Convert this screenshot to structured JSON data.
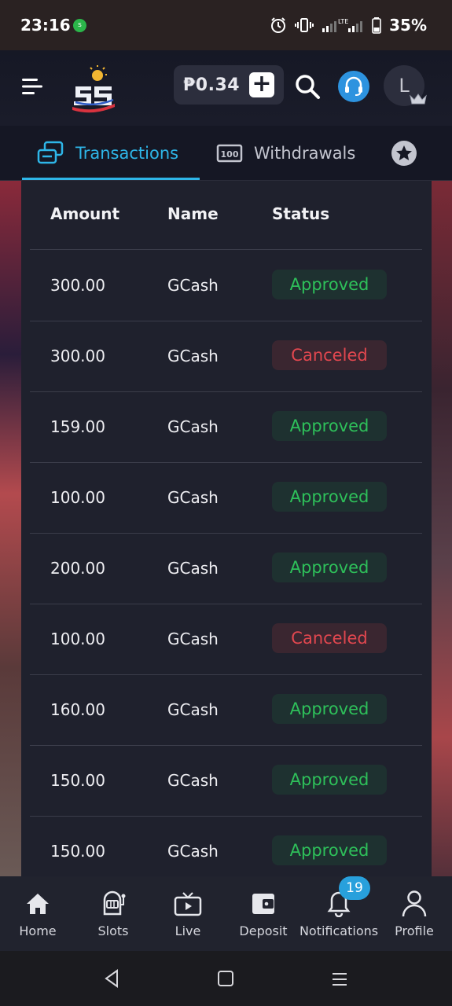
{
  "status_bar": {
    "time": "23:16",
    "app_icon_text": "s",
    "network_label": "LTE",
    "battery": "35%"
  },
  "header": {
    "balance": "₱0.34",
    "add_label": "+",
    "avatar_initial": "L"
  },
  "tabs": [
    {
      "label": "Transactions",
      "active": true
    },
    {
      "label": "Withdrawals",
      "active": false
    },
    {
      "label": "",
      "active": false
    }
  ],
  "table": {
    "headers": {
      "amount": "Amount",
      "name": "Name",
      "status": "Status"
    },
    "rows": [
      {
        "amount": "300.00",
        "name": "GCash",
        "status": "Approved"
      },
      {
        "amount": "300.00",
        "name": "GCash",
        "status": "Canceled"
      },
      {
        "amount": "159.00",
        "name": "GCash",
        "status": "Approved"
      },
      {
        "amount": "100.00",
        "name": "GCash",
        "status": "Approved"
      },
      {
        "amount": "200.00",
        "name": "GCash",
        "status": "Approved"
      },
      {
        "amount": "100.00",
        "name": "GCash",
        "status": "Canceled"
      },
      {
        "amount": "160.00",
        "name": "GCash",
        "status": "Approved"
      },
      {
        "amount": "150.00",
        "name": "GCash",
        "status": "Approved"
      },
      {
        "amount": "150.00",
        "name": "GCash",
        "status": "Approved"
      }
    ]
  },
  "bottom_nav": [
    {
      "label": "Home",
      "icon": "home-icon"
    },
    {
      "label": "Slots",
      "icon": "slots-icon"
    },
    {
      "label": "Live",
      "icon": "live-tv-icon"
    },
    {
      "label": "Deposit",
      "icon": "wallet-icon"
    },
    {
      "label": "Notifications",
      "icon": "bell-icon"
    },
    {
      "label": "Profile",
      "icon": "profile-icon"
    }
  ],
  "notifications_count": "19",
  "colors": {
    "accent": "#2eb6e8",
    "approved": "#2ec05a",
    "canceled": "#e1474f",
    "panel": "#1f212d"
  }
}
